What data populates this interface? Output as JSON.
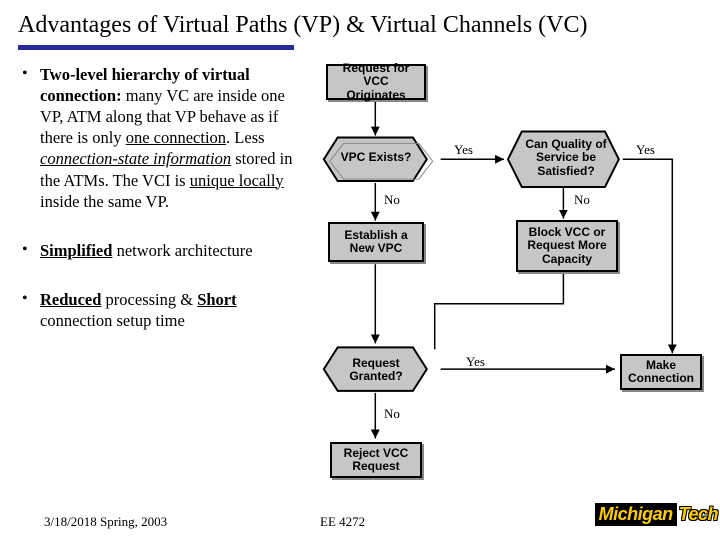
{
  "title": "Advantages of Virtual Paths (VP) & Virtual Channels (VC)",
  "bullets": {
    "b1": {
      "lead": "Two-level hierarchy of virtual connection:",
      "rest1": " many VC  are inside one VP, ATM along that VP behave as if there is only ",
      "one_conn": "one connection",
      "rest2": ". Less ",
      "csi": "connection-state information",
      "rest3": " stored in the ATMs. The VCI is ",
      "uniq": "unique locally",
      "rest4": " inside the same VP."
    },
    "b2": {
      "lead": "Simplified",
      "rest": " network architecture"
    },
    "b3": {
      "lead1": "Reduced",
      "mid": " processing  & ",
      "lead2": "Short",
      "rest": " connection setup time"
    }
  },
  "flow": {
    "start": "Request for VCC Originates",
    "vpc_exists": "VPC Exists?",
    "qos": "Can Quality of Service be Satisfied?",
    "establish": "Establish a New VPC",
    "block": "Block VCC or Request More Capacity",
    "granted": "Request Granted?",
    "make": "Make Connection",
    "reject": "Reject VCC Request",
    "yes": "Yes",
    "no": "No"
  },
  "footer": {
    "date": "3/18/2018 Spring, 2003",
    "course": "EE 4272"
  },
  "logo": {
    "michigan": "Michigan",
    "tech": "Tech"
  }
}
